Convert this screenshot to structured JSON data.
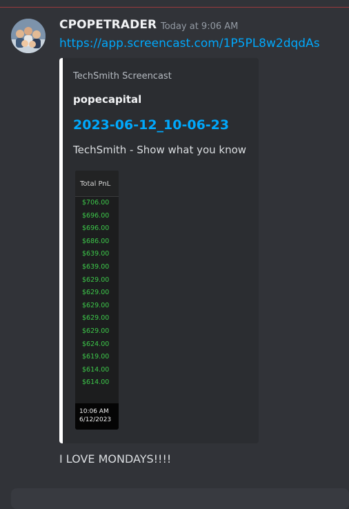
{
  "message": {
    "author": "CPOPETRADER",
    "timestamp": "Today at 9:06 AM",
    "link": "https://app.screencast.com/1P5PL8w2dqdAs",
    "text": "I LOVE MONDAYS!!!!"
  },
  "embed": {
    "provider": "TechSmith Screencast",
    "author": "popecapital",
    "title": "2023-06-12_10-06-23",
    "description": "TechSmith - Show what you know",
    "thumbnail": {
      "column_header": "Total PnL",
      "rows": [
        "$706.00",
        "$696.00",
        "$696.00",
        "$686.00",
        "$639.00",
        "$639.00",
        "$629.00",
        "$629.00",
        "$629.00",
        "$629.00",
        "$629.00",
        "$624.00",
        "$619.00",
        "$614.00",
        "$614.00"
      ],
      "clock_time": "10:06 AM",
      "clock_date": "6/12/2023"
    }
  },
  "colors": {
    "background": "#313338",
    "link": "#00a8fc",
    "profit_green": "#3dc94a",
    "new_messages_divider": "#f23f43",
    "embed_accent": "#ffffff"
  }
}
